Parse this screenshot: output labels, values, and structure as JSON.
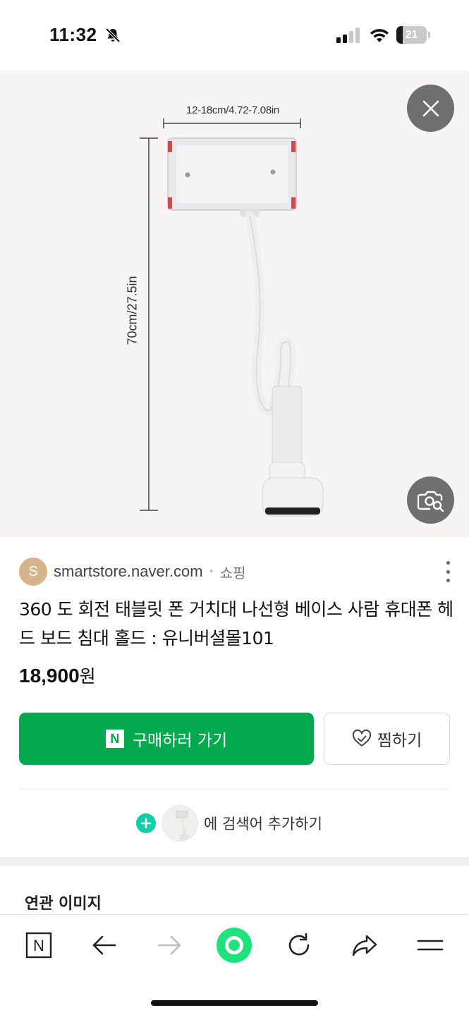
{
  "status_bar": {
    "time": "11:32",
    "battery_level": "21",
    "battery_fraction": 0.21,
    "icons": [
      "bell-slash-icon",
      "cellular-signal-icon",
      "wifi-icon",
      "battery-icon"
    ]
  },
  "image_viewer": {
    "dimension_width_label": "12-18cm/4.72-7.08in",
    "dimension_height_label": "70cm/27.5in",
    "close_icon": "close-icon",
    "lens_icon": "image-search-icon"
  },
  "result": {
    "source_initial": "S",
    "source_domain": "smartstore.naver.com",
    "source_separator": "•",
    "source_category": "쇼핑",
    "title": "360 도 회전 태블릿 폰 거치대 나선형 베이스 사람 휴대폰 헤드 보드 침대 홀드 : 유니버셜몰101",
    "price_value": "18,900",
    "price_unit": "원",
    "buy_button_logo": "N",
    "buy_button_label": "구매하러 가기",
    "save_button_label": "찜하기",
    "add_search_label": "에 검색어 추가하기"
  },
  "related": {
    "title": "연관 이미지"
  },
  "toolbar": {
    "home_logo": "N",
    "items": [
      "naver-home-icon",
      "back-arrow-icon",
      "forward-arrow-icon",
      "green-dot-icon",
      "refresh-icon",
      "share-icon",
      "menu-icon"
    ]
  },
  "colors": {
    "naver_green": "#03a94d",
    "mint_accent": "#0fcfaa",
    "center_button": "#1ee37c"
  }
}
